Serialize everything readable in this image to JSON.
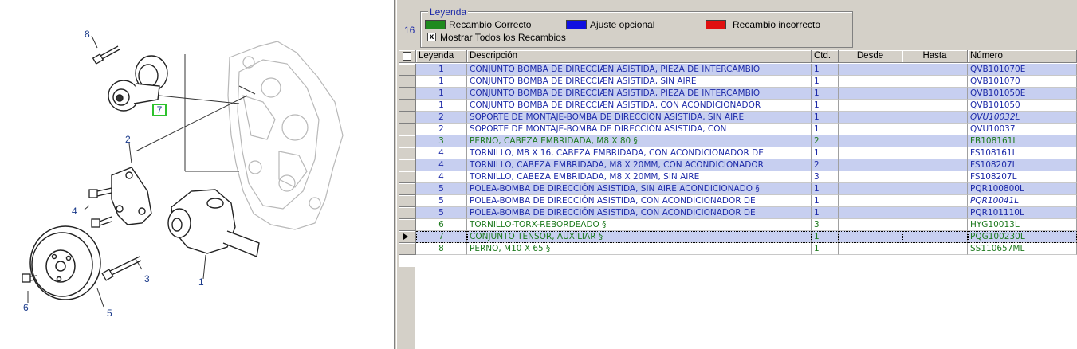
{
  "diagram": {
    "callouts": [
      "8",
      "7",
      "2",
      "4",
      "3",
      "1",
      "6",
      "5"
    ]
  },
  "legend": {
    "title": "Leyenda",
    "count": "16",
    "items": [
      {
        "label": "Recambio Correcto",
        "color": "#1e8a1e"
      },
      {
        "label": "Ajuste opcional",
        "color": "#1010e0"
      },
      {
        "label": "Recambio incorrecto",
        "color": "#e01010"
      }
    ],
    "show_all": {
      "label": "Mostrar Todos los Recambios",
      "checked": "x"
    }
  },
  "colors": {
    "blue_text": "#1d2aa8",
    "green_text": "#1e7a1e",
    "blue_row": "#c7cff0"
  },
  "grid": {
    "headers": [
      "Leyenda",
      "Descripción",
      "Ctd.",
      "Desde",
      "Hasta",
      "Número"
    ],
    "rows": [
      {
        "leyenda": "1",
        "descripcion": "CONJUNTO BOMBA DE DIRECCIÆN ASISTIDA, PIEZA DE INTERCAMBIO",
        "ctd": "1",
        "desde": "",
        "hasta": "",
        "numero": "QVB101070E",
        "color": "blue",
        "shaded": true,
        "italic": false
      },
      {
        "leyenda": "1",
        "descripcion": "CONJUNTO BOMBA DE DIRECCIÆN ASISTIDA, SIN AIRE",
        "ctd": "1",
        "desde": "",
        "hasta": "",
        "numero": "QVB101070",
        "color": "blue",
        "shaded": false,
        "italic": false
      },
      {
        "leyenda": "1",
        "descripcion": "CONJUNTO BOMBA DE DIRECCIÆN ASISTIDA, PIEZA DE INTERCAMBIO",
        "ctd": "1",
        "desde": "",
        "hasta": "",
        "numero": "QVB101050E",
        "color": "blue",
        "shaded": true,
        "italic": false
      },
      {
        "leyenda": "1",
        "descripcion": "CONJUNTO BOMBA DE DIRECCIÆN ASISTIDA, CON ACONDICIONADOR",
        "ctd": "1",
        "desde": "",
        "hasta": "",
        "numero": "QVB101050",
        "color": "blue",
        "shaded": false,
        "italic": false
      },
      {
        "leyenda": "2",
        "descripcion": "SOPORTE DE MONTAJE-BOMBA DE DIRECCIÓN ASISTIDA, SIN AIRE",
        "ctd": "1",
        "desde": "",
        "hasta": "",
        "numero": "QVU10032L",
        "color": "blue",
        "shaded": true,
        "italic": true
      },
      {
        "leyenda": "2",
        "descripcion": "SOPORTE DE MONTAJE-BOMBA DE DIRECCIÓN ASISTIDA, CON",
        "ctd": "1",
        "desde": "",
        "hasta": "",
        "numero": "QVU10037",
        "color": "blue",
        "shaded": false,
        "italic": false
      },
      {
        "leyenda": "3",
        "descripcion": "PERNO, CABEZA EMBRIDADA, M8 X 80 §",
        "ctd": "2",
        "desde": "",
        "hasta": "",
        "numero": "FB108161L",
        "color": "green",
        "shaded": true,
        "italic": false
      },
      {
        "leyenda": "4",
        "descripcion": "TORNILLO, M8 X 16, CABEZA EMBRIDADA, CON ACONDICIONADOR DE",
        "ctd": "1",
        "desde": "",
        "hasta": "",
        "numero": "FS108161L",
        "color": "blue",
        "shaded": false,
        "italic": false
      },
      {
        "leyenda": "4",
        "descripcion": "TORNILLO, CABEZA EMBRIDADA, M8 X 20MM, CON ACONDICIONADOR",
        "ctd": "2",
        "desde": "",
        "hasta": "",
        "numero": "FS108207L",
        "color": "blue",
        "shaded": true,
        "italic": false
      },
      {
        "leyenda": "4",
        "descripcion": "TORNILLO, CABEZA EMBRIDADA, M8 X 20MM, SIN AIRE",
        "ctd": "3",
        "desde": "",
        "hasta": "",
        "numero": "FS108207L",
        "color": "blue",
        "shaded": false,
        "italic": false
      },
      {
        "leyenda": "5",
        "descripcion": "POLEA-BOMBA DE DIRECCIÓN ASISTIDA, SIN AIRE ACONDICIONADO §",
        "ctd": "1",
        "desde": "",
        "hasta": "",
        "numero": "PQR100800L",
        "color": "blue",
        "shaded": true,
        "italic": false
      },
      {
        "leyenda": "5",
        "descripcion": "POLEA-BOMBA DE DIRECCIÓN ASISTIDA, CON ACONDICIONADOR DE",
        "ctd": "1",
        "desde": "",
        "hasta": "",
        "numero": "PQR10041L",
        "color": "blue",
        "shaded": false,
        "italic": true
      },
      {
        "leyenda": "5",
        "descripcion": "POLEA-BOMBA DE DIRECCIÓN ASISTIDA, CON ACONDICIONADOR DE",
        "ctd": "1",
        "desde": "",
        "hasta": "",
        "numero": "PQR101110L",
        "color": "blue",
        "shaded": true,
        "italic": false
      },
      {
        "leyenda": "6",
        "descripcion": "TORNILLO-TORX-REBORDEADO §",
        "ctd": "3",
        "desde": "",
        "hasta": "",
        "numero": "HYG10013L",
        "color": "green",
        "shaded": false,
        "italic": false
      },
      {
        "leyenda": "7",
        "descripcion": "CONJUNTO TENSOR, AUXILIAR §",
        "ctd": "1",
        "desde": "",
        "hasta": "",
        "numero": "PQG100230L",
        "color": "green",
        "shaded": true,
        "italic": false,
        "current": true
      },
      {
        "leyenda": "8",
        "descripcion": "PERNO, M10 X 65 §",
        "ctd": "1",
        "desde": "",
        "hasta": "",
        "numero": "SS110657ML",
        "color": "green",
        "shaded": false,
        "italic": false
      }
    ]
  }
}
